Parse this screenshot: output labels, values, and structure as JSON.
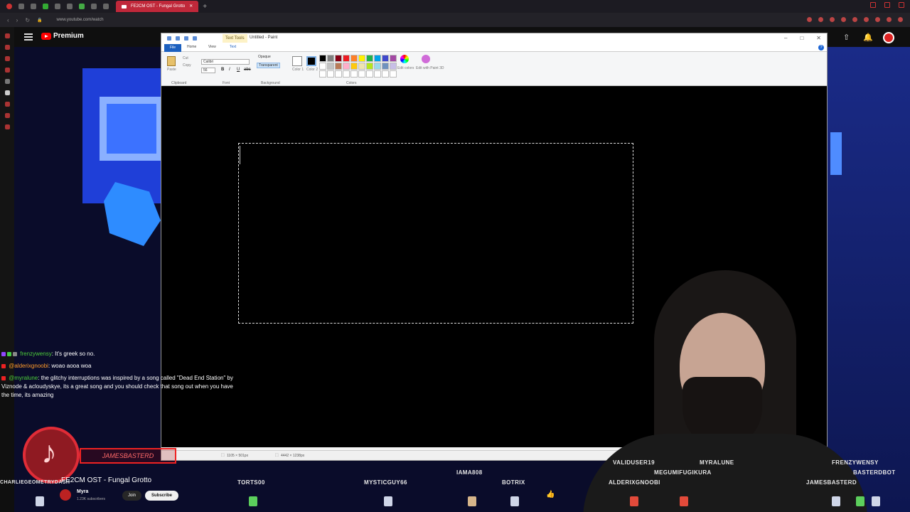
{
  "browser": {
    "tab_title": "FE2CM OST - Fungal Grotto",
    "url": "www.youtube.com/watch"
  },
  "youtube": {
    "premium_label": "Premium",
    "song_title": "FE2CM OST - Fungal Grotto",
    "channel_name": "Myra",
    "subscribers": "1.23K subscribers",
    "join_label": "Join",
    "subscribe_label": "Subscribe"
  },
  "paint": {
    "text_tools_label": "Text Tools",
    "window_title": "Untitled - Paint",
    "tabs": [
      "File",
      "Home",
      "View",
      "Text"
    ],
    "groups": {
      "clipboard": "Clipboard",
      "font": "Font",
      "background": "Background",
      "colors": "Colors"
    },
    "paste_label": "Paste",
    "cut_label": "Cut",
    "copy_label": "Copy",
    "font_name": "Calibri",
    "font_size": "56",
    "bg_options": [
      "Opaque",
      "Transparent"
    ],
    "color1_label": "Color 1",
    "color2_label": "Color 2",
    "edit_colors_label": "Edit colors",
    "edit_3d_label": "Edit with Paint 3D",
    "status_selection": "1105 × 501px",
    "status_size": "4442 × 1238px",
    "palette": [
      "#000000",
      "#7f7f7f",
      "#880015",
      "#ed1c24",
      "#ff7f27",
      "#fff200",
      "#22b14c",
      "#00a2e8",
      "#3f48cc",
      "#a349a4",
      "#ffffff",
      "#c3c3c3",
      "#b97a57",
      "#ffaec9",
      "#ffc90e",
      "#efe4b0",
      "#b5e61d",
      "#99d9ea",
      "#7092be",
      "#c8bfe7",
      "#ffffff",
      "#ffffff",
      "#ffffff",
      "#ffffff",
      "#ffffff",
      "#ffffff",
      "#ffffff",
      "#ffffff",
      "#ffffff",
      "#ffffff"
    ]
  },
  "chat": [
    {
      "user": "frenzywensy",
      "message": ": It's greek so no."
    },
    {
      "user": "@alderixgnoobi",
      "message": ": woao aooa woa"
    },
    {
      "user": "@myralune",
      "message": ": the glitchy interruptions was inspired by a song called \"Dead End Station\" by Viznode & acloudyskye, its a great song and you should check that song out when you have the time, its amazing"
    }
  ],
  "overlay": {
    "name_banner": "JAMESBASTERD",
    "viewers": [
      "CHARLIEGEOMETRYDASH",
      "TORTS00",
      "MYSTICGUY66",
      "IAMA808",
      "BOTRIX",
      "VALIDUSER19",
      "MYRALUNE",
      "MEGUMIFUGIKURA",
      "ALDERIXGNOOBI",
      "FRENZYWENSY",
      "BASTERDBOT",
      "JAMESBASTERD"
    ]
  }
}
